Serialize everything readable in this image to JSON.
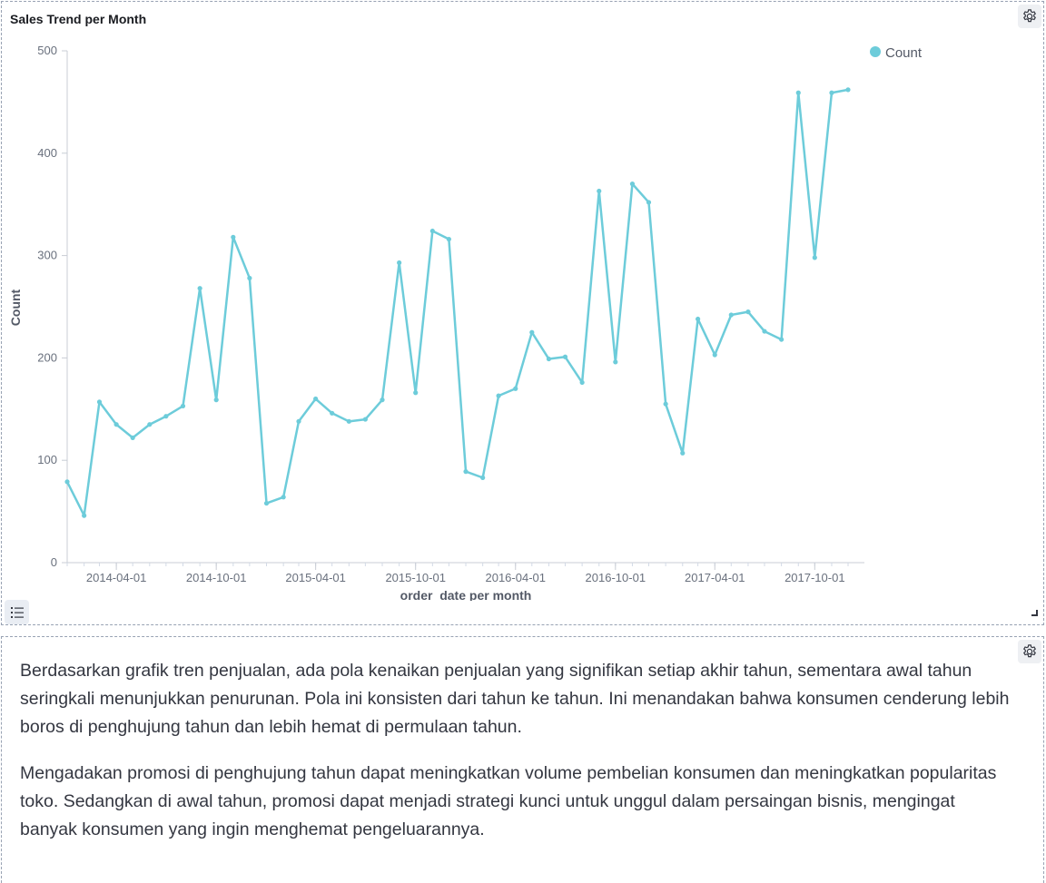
{
  "panel_chart": {
    "title": "Sales Trend per Month"
  },
  "chart_data": {
    "type": "line",
    "title": "Sales Trend per Month",
    "xlabel": "order_date per month",
    "ylabel": "Count",
    "ylim": [
      0,
      500
    ],
    "yticks": [
      "0",
      "100",
      "200",
      "300",
      "400",
      "500"
    ],
    "xticks": [
      "2014-04-01",
      "2014-10-01",
      "2015-04-01",
      "2015-10-01",
      "2016-04-01",
      "2016-10-01",
      "2017-04-01",
      "2017-10-01"
    ],
    "x": [
      "2014-01-01",
      "2014-02-01",
      "2014-03-01",
      "2014-04-01",
      "2014-05-01",
      "2014-06-01",
      "2014-07-01",
      "2014-08-01",
      "2014-09-01",
      "2014-10-01",
      "2014-11-01",
      "2014-12-01",
      "2015-01-01",
      "2015-02-01",
      "2015-03-01",
      "2015-04-01",
      "2015-05-01",
      "2015-06-01",
      "2015-07-01",
      "2015-08-01",
      "2015-09-01",
      "2015-10-01",
      "2015-11-01",
      "2015-12-01",
      "2016-01-01",
      "2016-02-01",
      "2016-03-01",
      "2016-04-01",
      "2016-05-01",
      "2016-06-01",
      "2016-07-01",
      "2016-08-01",
      "2016-09-01",
      "2016-10-01",
      "2016-11-01",
      "2016-12-01",
      "2017-01-01",
      "2017-02-01",
      "2017-03-01",
      "2017-04-01",
      "2017-05-01",
      "2017-06-01",
      "2017-07-01",
      "2017-08-01",
      "2017-09-01",
      "2017-10-01",
      "2017-11-01",
      "2017-12-01"
    ],
    "series": [
      {
        "name": "Count",
        "values": [
          79,
          46,
          157,
          135,
          122,
          135,
          143,
          153,
          268,
          159,
          318,
          278,
          58,
          64,
          138,
          160,
          146,
          138,
          140,
          159,
          293,
          166,
          324,
          316,
          89,
          83,
          163,
          170,
          225,
          199,
          201,
          176,
          363,
          196,
          370,
          352,
          155,
          107,
          238,
          203,
          242,
          245,
          226,
          218,
          459,
          298,
          459,
          462
        ]
      }
    ],
    "legend": "top-right",
    "grid": false,
    "line_color": "#6dccda"
  },
  "panel_text": {
    "paragraphs": [
      "Berdasarkan grafik tren penjualan, ada pola kenaikan penjualan yang signifikan setiap akhir tahun, sementara awal tahun seringkali menunjukkan penurunan. Pola ini konsisten dari tahun ke tahun. Ini menandakan bahwa konsumen cenderung lebih boros di penghujung tahun dan lebih hemat di permulaan tahun.",
      "Mengadakan promosi di penghujung tahun dapat meningkatkan volume pembelian konsumen dan meningkatkan popularitas toko. Sedangkan di awal tahun, promosi dapat menjadi strategi kunci untuk unggul dalam persaingan bisnis, mengingat banyak konsumen yang ingin menghemat pengeluarannya."
    ]
  },
  "icons": {
    "panel_options": "gear-icon",
    "legend_toggle": "list-icon",
    "resize": "resize-handle-icon"
  }
}
